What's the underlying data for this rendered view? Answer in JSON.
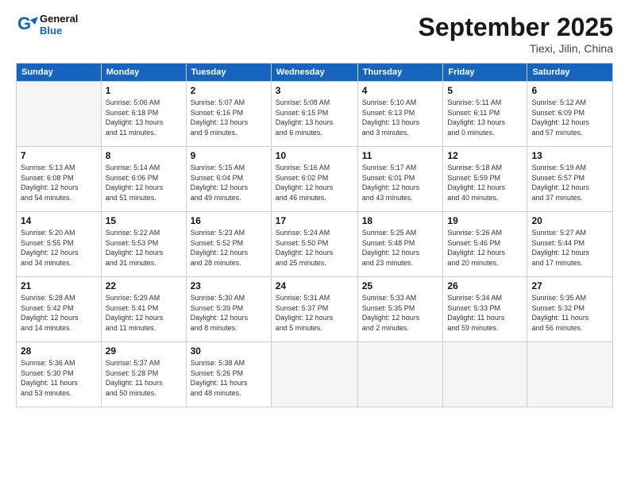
{
  "logo": {
    "line1": "General",
    "line2": "Blue"
  },
  "title": "September 2025",
  "location": "Tiexi, Jilin, China",
  "weekdays": [
    "Sunday",
    "Monday",
    "Tuesday",
    "Wednesday",
    "Thursday",
    "Friday",
    "Saturday"
  ],
  "weeks": [
    [
      {
        "day": "",
        "info": ""
      },
      {
        "day": "1",
        "info": "Sunrise: 5:06 AM\nSunset: 6:18 PM\nDaylight: 13 hours\nand 11 minutes."
      },
      {
        "day": "2",
        "info": "Sunrise: 5:07 AM\nSunset: 6:16 PM\nDaylight: 13 hours\nand 9 minutes."
      },
      {
        "day": "3",
        "info": "Sunrise: 5:08 AM\nSunset: 6:15 PM\nDaylight: 13 hours\nand 6 minutes."
      },
      {
        "day": "4",
        "info": "Sunrise: 5:10 AM\nSunset: 6:13 PM\nDaylight: 13 hours\nand 3 minutes."
      },
      {
        "day": "5",
        "info": "Sunrise: 5:11 AM\nSunset: 6:11 PM\nDaylight: 13 hours\nand 0 minutes."
      },
      {
        "day": "6",
        "info": "Sunrise: 5:12 AM\nSunset: 6:09 PM\nDaylight: 12 hours\nand 57 minutes."
      }
    ],
    [
      {
        "day": "7",
        "info": "Sunrise: 5:13 AM\nSunset: 6:08 PM\nDaylight: 12 hours\nand 54 minutes."
      },
      {
        "day": "8",
        "info": "Sunrise: 5:14 AM\nSunset: 6:06 PM\nDaylight: 12 hours\nand 51 minutes."
      },
      {
        "day": "9",
        "info": "Sunrise: 5:15 AM\nSunset: 6:04 PM\nDaylight: 12 hours\nand 49 minutes."
      },
      {
        "day": "10",
        "info": "Sunrise: 5:16 AM\nSunset: 6:02 PM\nDaylight: 12 hours\nand 46 minutes."
      },
      {
        "day": "11",
        "info": "Sunrise: 5:17 AM\nSunset: 6:01 PM\nDaylight: 12 hours\nand 43 minutes."
      },
      {
        "day": "12",
        "info": "Sunrise: 5:18 AM\nSunset: 5:59 PM\nDaylight: 12 hours\nand 40 minutes."
      },
      {
        "day": "13",
        "info": "Sunrise: 5:19 AM\nSunset: 5:57 PM\nDaylight: 12 hours\nand 37 minutes."
      }
    ],
    [
      {
        "day": "14",
        "info": "Sunrise: 5:20 AM\nSunset: 5:55 PM\nDaylight: 12 hours\nand 34 minutes."
      },
      {
        "day": "15",
        "info": "Sunrise: 5:22 AM\nSunset: 5:53 PM\nDaylight: 12 hours\nand 31 minutes."
      },
      {
        "day": "16",
        "info": "Sunrise: 5:23 AM\nSunset: 5:52 PM\nDaylight: 12 hours\nand 28 minutes."
      },
      {
        "day": "17",
        "info": "Sunrise: 5:24 AM\nSunset: 5:50 PM\nDaylight: 12 hours\nand 25 minutes."
      },
      {
        "day": "18",
        "info": "Sunrise: 5:25 AM\nSunset: 5:48 PM\nDaylight: 12 hours\nand 23 minutes."
      },
      {
        "day": "19",
        "info": "Sunrise: 5:26 AM\nSunset: 5:46 PM\nDaylight: 12 hours\nand 20 minutes."
      },
      {
        "day": "20",
        "info": "Sunrise: 5:27 AM\nSunset: 5:44 PM\nDaylight: 12 hours\nand 17 minutes."
      }
    ],
    [
      {
        "day": "21",
        "info": "Sunrise: 5:28 AM\nSunset: 5:42 PM\nDaylight: 12 hours\nand 14 minutes."
      },
      {
        "day": "22",
        "info": "Sunrise: 5:29 AM\nSunset: 5:41 PM\nDaylight: 12 hours\nand 11 minutes."
      },
      {
        "day": "23",
        "info": "Sunrise: 5:30 AM\nSunset: 5:39 PM\nDaylight: 12 hours\nand 8 minutes."
      },
      {
        "day": "24",
        "info": "Sunrise: 5:31 AM\nSunset: 5:37 PM\nDaylight: 12 hours\nand 5 minutes."
      },
      {
        "day": "25",
        "info": "Sunrise: 5:33 AM\nSunset: 5:35 PM\nDaylight: 12 hours\nand 2 minutes."
      },
      {
        "day": "26",
        "info": "Sunrise: 5:34 AM\nSunset: 5:33 PM\nDaylight: 11 hours\nand 59 minutes."
      },
      {
        "day": "27",
        "info": "Sunrise: 5:35 AM\nSunset: 5:32 PM\nDaylight: 11 hours\nand 56 minutes."
      }
    ],
    [
      {
        "day": "28",
        "info": "Sunrise: 5:36 AM\nSunset: 5:30 PM\nDaylight: 11 hours\nand 53 minutes."
      },
      {
        "day": "29",
        "info": "Sunrise: 5:37 AM\nSunset: 5:28 PM\nDaylight: 11 hours\nand 50 minutes."
      },
      {
        "day": "30",
        "info": "Sunrise: 5:38 AM\nSunset: 5:26 PM\nDaylight: 11 hours\nand 48 minutes."
      },
      {
        "day": "",
        "info": ""
      },
      {
        "day": "",
        "info": ""
      },
      {
        "day": "",
        "info": ""
      },
      {
        "day": "",
        "info": ""
      }
    ]
  ]
}
